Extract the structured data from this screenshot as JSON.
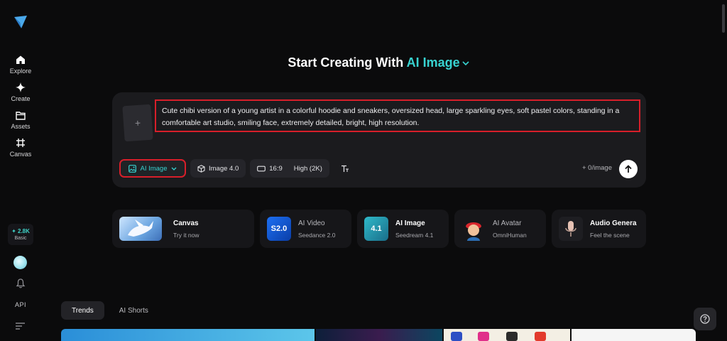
{
  "sidebar": {
    "items": [
      {
        "label": "Explore",
        "icon": "home-icon"
      },
      {
        "label": "Create",
        "icon": "sparkle-icon"
      },
      {
        "label": "Assets",
        "icon": "folder-icon"
      },
      {
        "label": "Canvas",
        "icon": "canvas-grid-icon"
      }
    ],
    "credits_amount": "✦ 2.8K",
    "plan": "Basic",
    "api_label": "API"
  },
  "heading": {
    "prefix": "Start Creating With",
    "mode": "AI Image"
  },
  "prompt": {
    "text": "Cute chibi version of a young artist in a colorful hoodie and sneakers, oversized head, large sparkling eyes, soft pastel colors, standing in a comfortable art studio, smiling face, extremely detailed, bright, high resolution.",
    "upload_glyph": "+"
  },
  "toolbar": {
    "mode_label": "AI Image",
    "model_label": "Image 4.0",
    "ratio_label": "16:9",
    "quality_label": "High (2K)",
    "credit_cost": "+ 0/image"
  },
  "cards": [
    {
      "title": "Canvas",
      "sub": "Try it now"
    },
    {
      "title": "AI Video",
      "sub": "Seedance 2.0",
      "badge": "S2.0"
    },
    {
      "title": "AI Image",
      "sub": "Seedream 4.1",
      "badge": "4.1"
    },
    {
      "title": "AI Avatar",
      "sub": "OmniHuman"
    },
    {
      "title": "Audio Genera",
      "sub": "Feel the scene"
    }
  ],
  "tabs": [
    {
      "label": "Trends",
      "active": true
    },
    {
      "label": "AI Shorts",
      "active": false
    }
  ],
  "colors": {
    "accent": "#38d3d1",
    "highlight": "#d71f2a",
    "background": "#0b0b0c",
    "panel": "#1b1b1e"
  }
}
